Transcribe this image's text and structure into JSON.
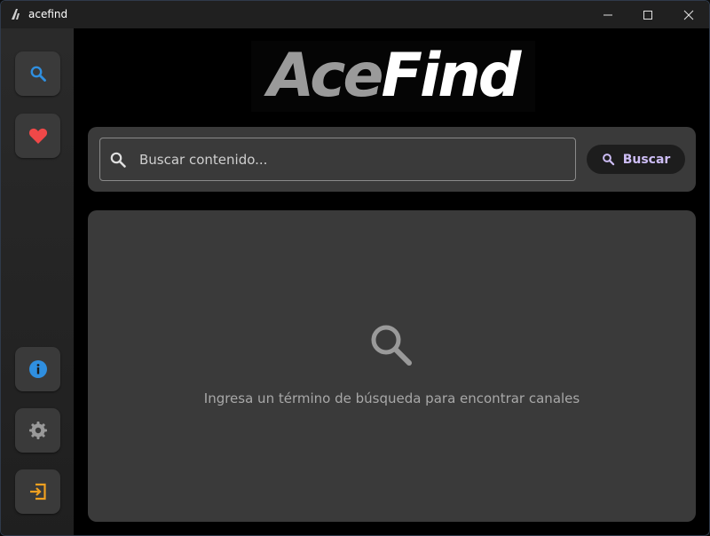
{
  "window": {
    "title": "acefind",
    "controls": [
      "minimize-icon",
      "maximize-icon",
      "close-icon"
    ]
  },
  "sidebar": {
    "items": [
      {
        "name": "search",
        "icon": "search-icon",
        "color": "#2f8fe0"
      },
      {
        "name": "favorites",
        "icon": "heart-icon",
        "color": "#f04848"
      },
      {
        "name": "info",
        "icon": "info-icon",
        "color": "#2f8fe0"
      },
      {
        "name": "settings",
        "icon": "gear-icon",
        "color": "#9a9a9a"
      },
      {
        "name": "exit",
        "icon": "exit-icon",
        "color": "#f0a020"
      }
    ]
  },
  "logo": {
    "part1": "Ace",
    "part2": "Find"
  },
  "search": {
    "placeholder": "Buscar contenido...",
    "value": "",
    "button_label": "Buscar",
    "button_text_color": "#cdbdf5"
  },
  "results": {
    "empty_message": "Ingresa un término de búsqueda para encontrar canales"
  },
  "colors": {
    "background": "#000000",
    "panel": "#3a3a3a",
    "sidebar": "#2a2a2a"
  }
}
